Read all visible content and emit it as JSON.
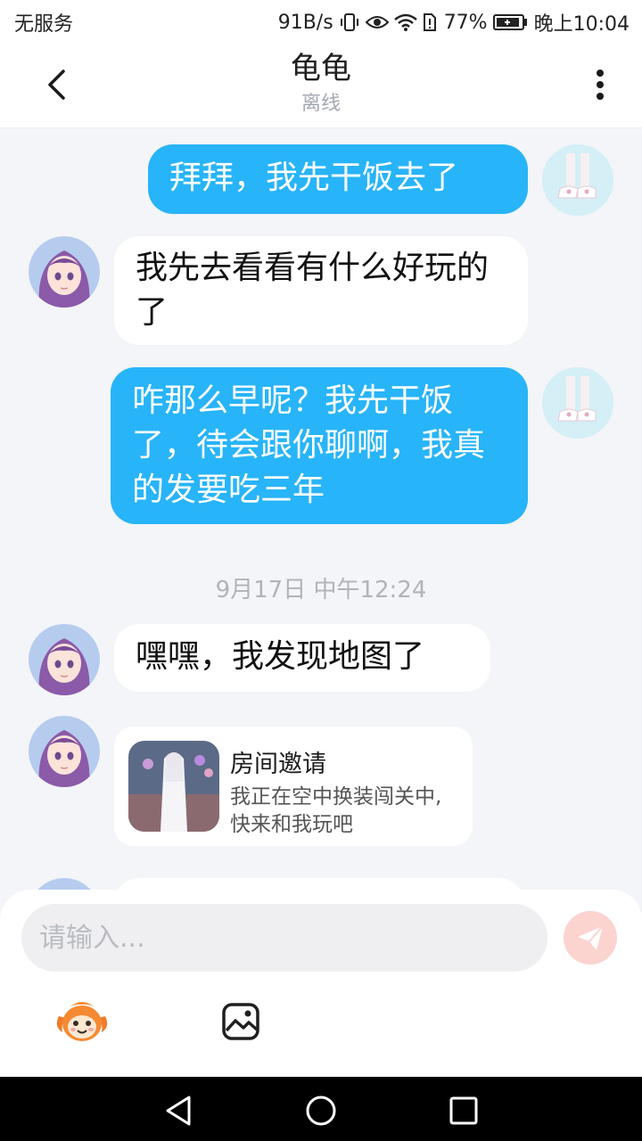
{
  "status_bar": {
    "carrier": "无服务",
    "net_speed": "91B/s",
    "battery_percent": "77%",
    "time": "晚上10:04"
  },
  "header": {
    "title": "龟龟",
    "status": "离线"
  },
  "messages": [
    {
      "side": "out",
      "text": "拜拜，我先干饭去了"
    },
    {
      "side": "in",
      "text": "我先去看看有什么好玩的了"
    },
    {
      "side": "out",
      "text": "咋那么早呢？我先干饭了，待会跟你聊啊，我真的发要吃三年"
    }
  ],
  "timestamp": "9月17日 中午12:24",
  "messages_after": [
    {
      "side": "in",
      "text": "嘿嘿，我发现地图了"
    }
  ],
  "invite_card": {
    "title": "房间邀请",
    "description": "我正在空中换装闯关中, 快来和我玩吧"
  },
  "input": {
    "placeholder": "请输入..."
  },
  "colors": {
    "outgoing_bubble": "#28b4f8",
    "incoming_bubble": "#ffffff",
    "background": "#f3f5f8",
    "send_button": "#fbd3cf"
  },
  "icons": [
    "back-arrow-icon",
    "more-vertical-icon",
    "send-icon",
    "emoji-mascot-icon",
    "image-icon",
    "nav-back-icon",
    "nav-home-icon",
    "nav-recents-icon"
  ]
}
